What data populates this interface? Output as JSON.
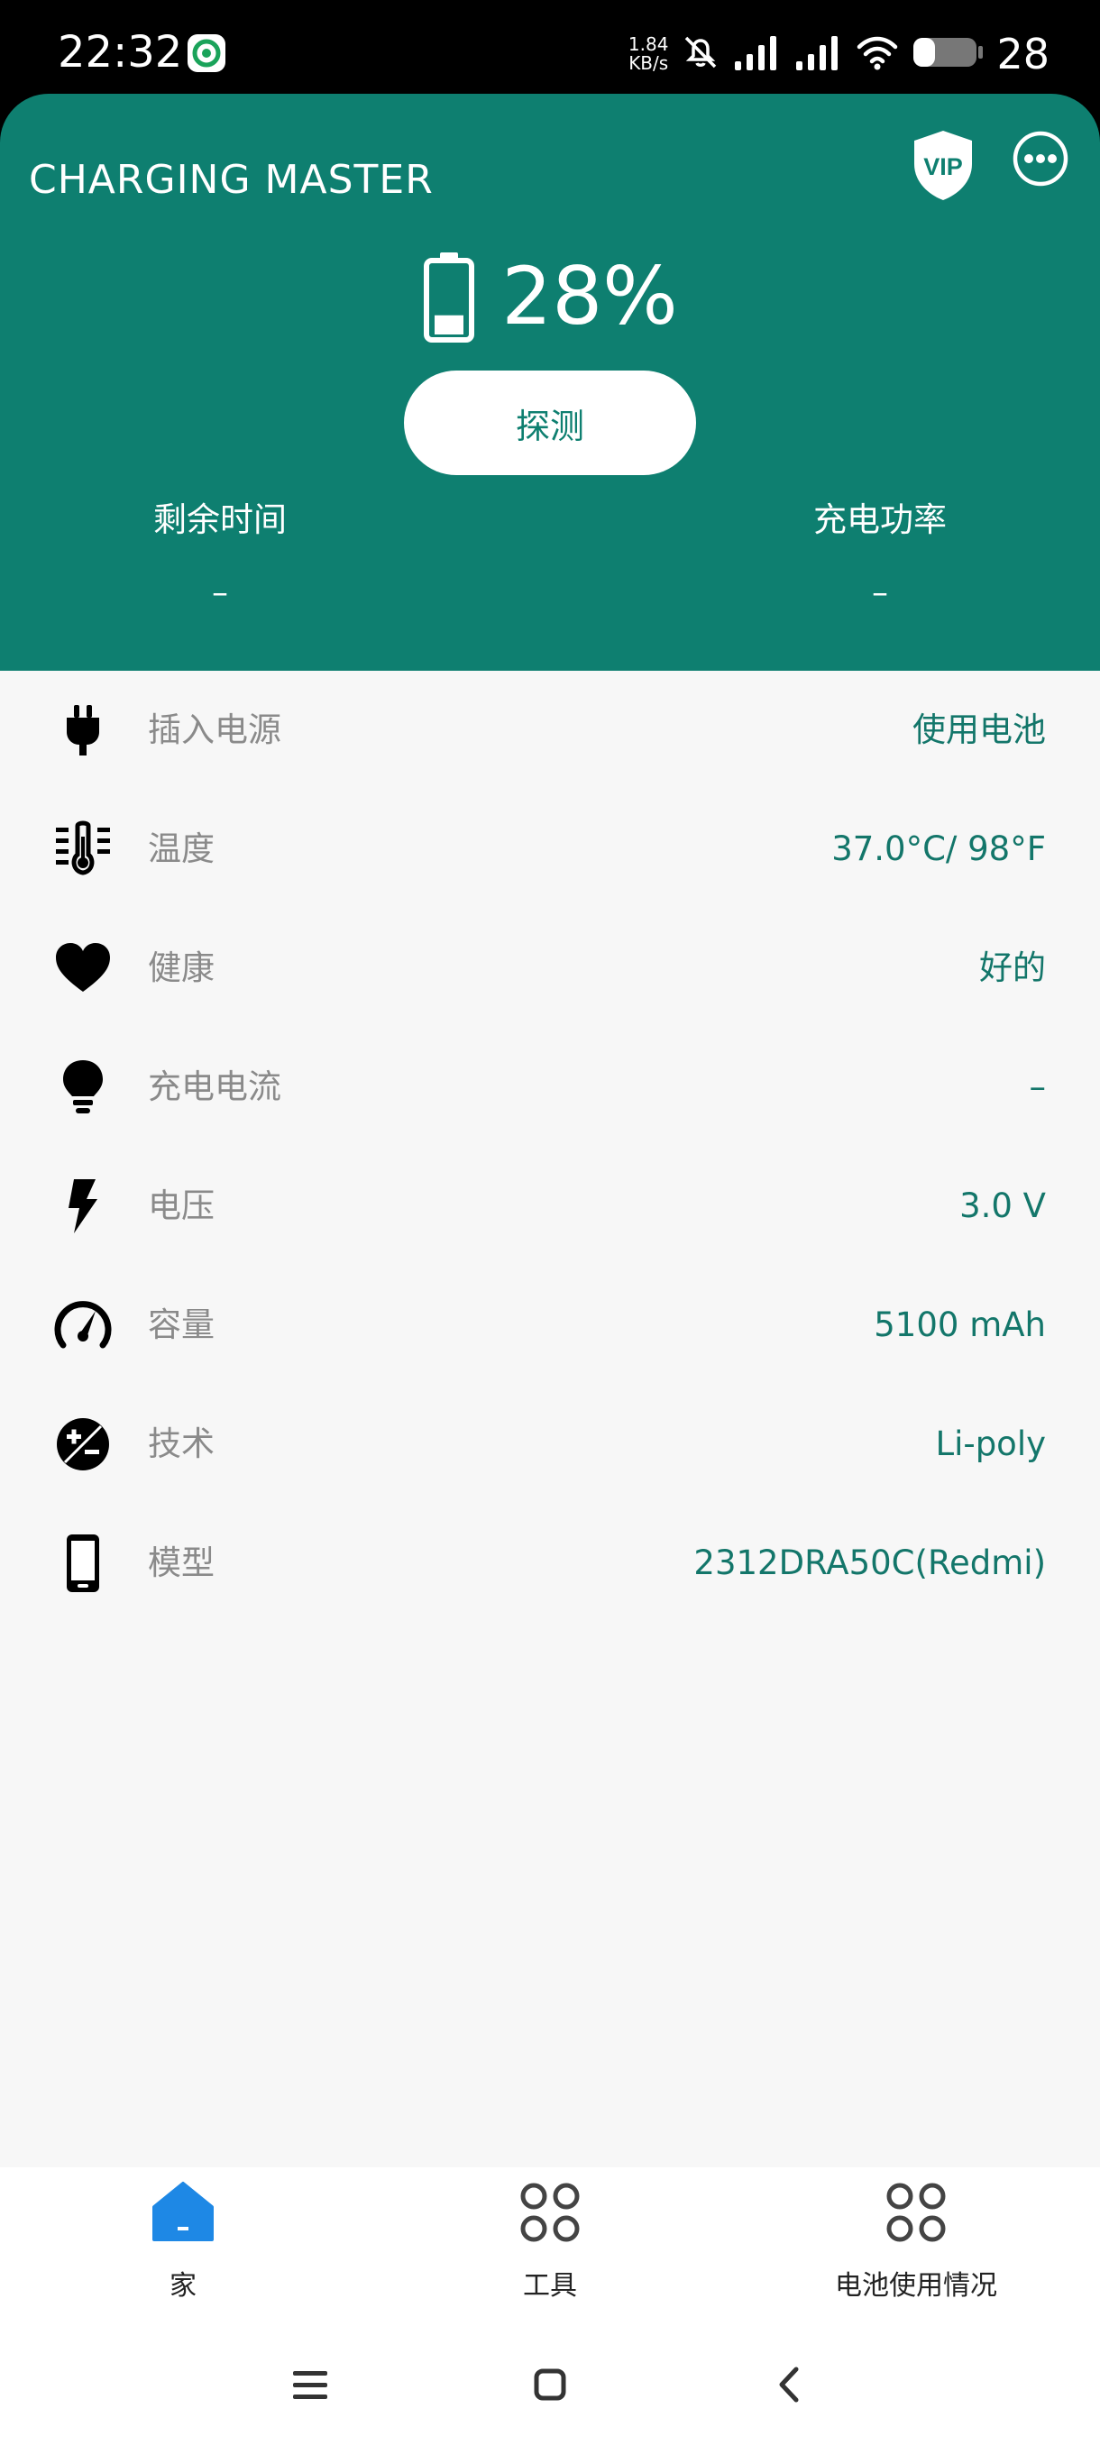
{
  "status_bar": {
    "time": "22:32",
    "net_speed_value": "1.84",
    "net_speed_unit": "KB/s",
    "battery_level": "28",
    "icons": [
      "app-notification-icon",
      "mute-icon",
      "signal-icon",
      "signal-icon",
      "wifi-icon",
      "battery-icon"
    ]
  },
  "header": {
    "app_title": "CHARGING MASTER",
    "vip_label": "VIP",
    "battery_percent": "28%",
    "battery_level_fraction": 0.28,
    "detect_button_label": "探测",
    "remaining_time_label": "剩余时间",
    "remaining_time_value": "–",
    "charging_power_label": "充电功率",
    "charging_power_value": "–"
  },
  "info": {
    "items": [
      {
        "icon": "plug-icon",
        "label": "插入电源",
        "value": "使用电池"
      },
      {
        "icon": "thermometer-icon",
        "label": "温度",
        "value": "37.0°C/ 98°F"
      },
      {
        "icon": "heart-icon",
        "label": "健康",
        "value": "好的"
      },
      {
        "icon": "lightbulb-icon",
        "label": "充电电流",
        "value": "–"
      },
      {
        "icon": "lightning-icon",
        "label": "电压",
        "value": "3.0 V"
      },
      {
        "icon": "speedometer-icon",
        "label": "容量",
        "value": "5100 mAh"
      },
      {
        "icon": "plus-minus-icon",
        "label": "技术",
        "value": "Li-poly"
      },
      {
        "icon": "phone-icon",
        "label": "模型",
        "value": "2312DRA50C(Redmi)"
      }
    ]
  },
  "bottom_nav": {
    "items": [
      {
        "label": "家",
        "icon": "home-icon",
        "active": true
      },
      {
        "label": "工具",
        "icon": "grid-icon",
        "active": false
      },
      {
        "label": "电池使用情况",
        "icon": "grid-icon",
        "active": false
      }
    ]
  },
  "colors": {
    "header_bg": "#0e7f70",
    "value_text": "#13766a",
    "label_text": "#8a8a8a",
    "list_bg": "#f7f7f7",
    "active_nav": "#1e88e5"
  }
}
